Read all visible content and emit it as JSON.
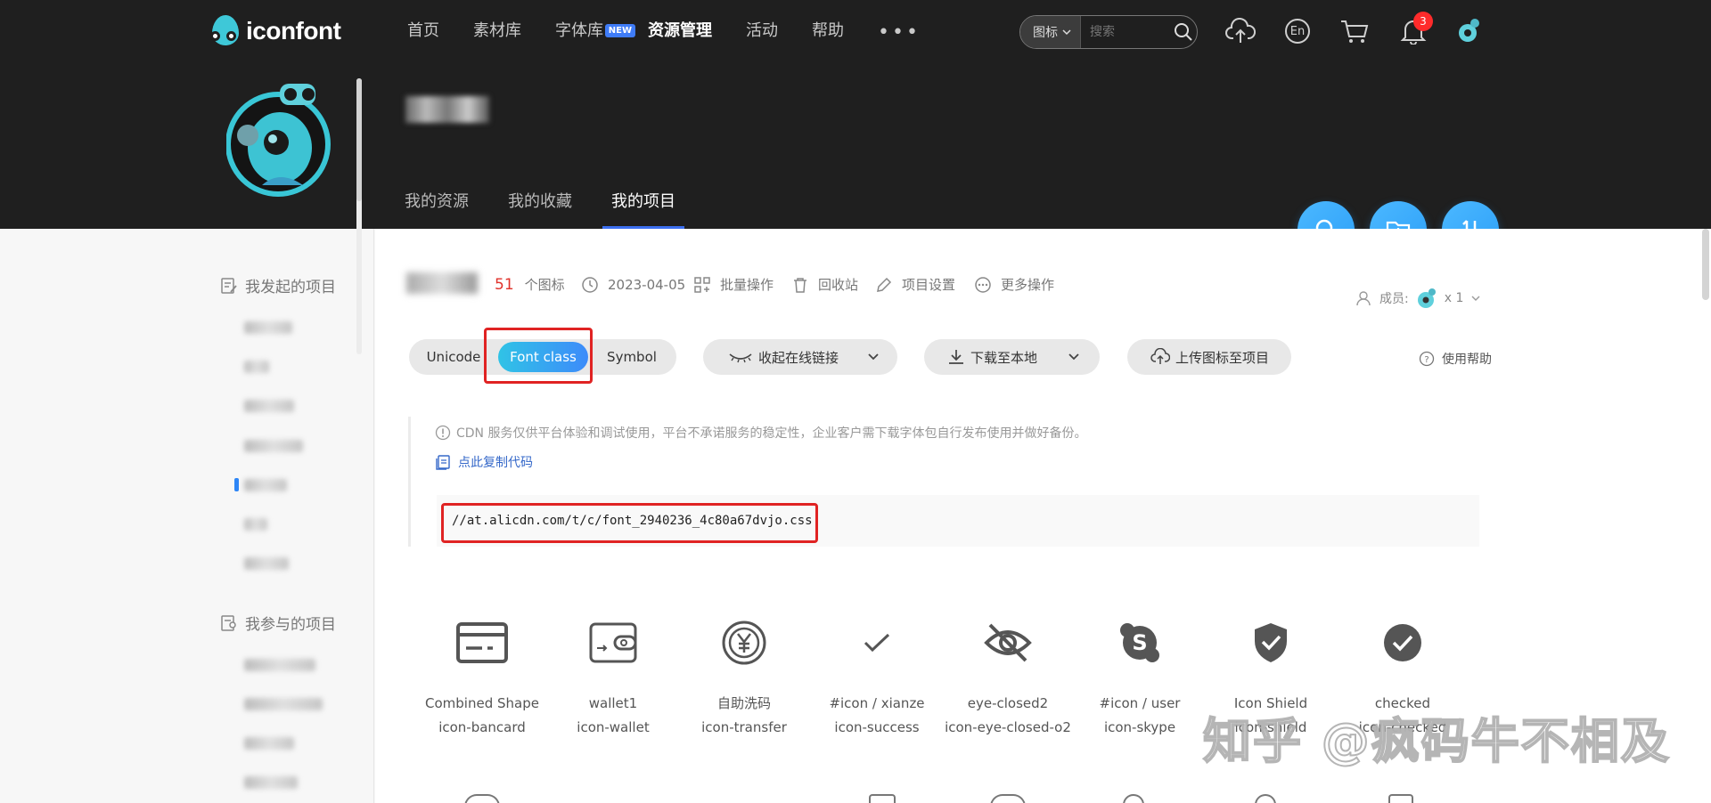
{
  "header": {
    "logo_text": "iconfont",
    "nav": [
      {
        "label": "首页"
      },
      {
        "label": "素材库"
      },
      {
        "label": "字体库",
        "badge": "NEW"
      },
      {
        "label": "资源管理",
        "active": true
      },
      {
        "label": "活动"
      },
      {
        "label": "帮助"
      }
    ],
    "more_label": "•••",
    "search": {
      "type_label": "图标",
      "placeholder": "搜索"
    },
    "notification_count": "3",
    "lang_label": "En"
  },
  "subnav": [
    {
      "label": "我的资源"
    },
    {
      "label": "我的收藏"
    },
    {
      "label": "我的项目",
      "active": true
    }
  ],
  "sidebar": {
    "initiated_title": "我发起的项目",
    "joined_title": "我参与的项目"
  },
  "project": {
    "icon_count": "51",
    "icon_count_unit": "个图标",
    "date": "2023-04-05",
    "actions": [
      "批量操作",
      "回收站",
      "项目设置",
      "更多操作"
    ],
    "members_label": "成员:",
    "members_count": "x 1"
  },
  "tabs": {
    "unicode": "Unicode",
    "font_class": "Font class",
    "symbol": "Symbol"
  },
  "toolbar": {
    "collapse_link": "收起在线链接",
    "download": "下载至本地",
    "upload": "上传图标至项目",
    "help": "使用帮助"
  },
  "cdn": {
    "notice": "CDN 服务仅供平台体验和调试使用，平台不承诺服务的稳定性，企业客户需下载字体包自行发布使用并做好备份。",
    "copy_label": "点此复制代码",
    "url": "//at.alicdn.com/t/c/font_2940236_4c80a67dvjo.css"
  },
  "icons": [
    {
      "name": "Combined Shape",
      "class": "icon-bancard",
      "glyph": "card-icon"
    },
    {
      "name": "wallet1",
      "class": "icon-wallet",
      "glyph": "wallet-icon"
    },
    {
      "name": "自助洗码",
      "class": "icon-transfer",
      "glyph": "yen-coin-icon"
    },
    {
      "name": "#icon / xianze",
      "class": "icon-success",
      "glyph": "check-icon"
    },
    {
      "name": "eye-closed2",
      "class": "icon-eye-closed-o2",
      "glyph": "eye-closed-icon"
    },
    {
      "name": "#icon / user",
      "class": "icon-skype",
      "glyph": "skype-icon"
    },
    {
      "name": "Icon Shield",
      "class": "icon-shield",
      "glyph": "shield-check-icon"
    },
    {
      "name": "checked",
      "class": "icon-checked",
      "glyph": "check-circle-icon"
    }
  ],
  "watermark": "知乎 @疯码牛不相及"
}
